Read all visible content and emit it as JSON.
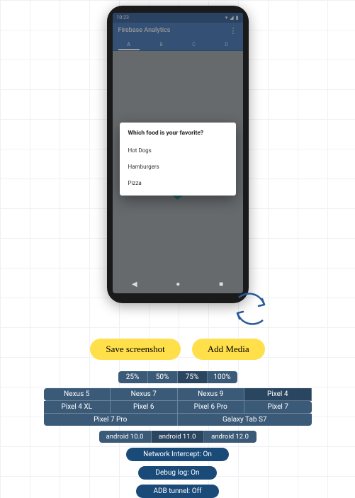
{
  "phone": {
    "status_time": "10:23",
    "app_title": "Firebase Analytics",
    "tabs": [
      "A",
      "B",
      "C",
      "D"
    ],
    "active_tab_index": 0,
    "dialog": {
      "title": "Which food is your favorite?",
      "options": [
        "Hot Dogs",
        "Hamburgers",
        "Pizza"
      ]
    },
    "nav_back": "◀",
    "nav_home": "●",
    "nav_recent": "■"
  },
  "actions": {
    "save_screenshot": "Save screenshot",
    "add_media": "Add Media"
  },
  "zoom": {
    "levels": [
      "25%",
      "50%",
      "75%",
      "100%"
    ],
    "active_index": 2
  },
  "devices": {
    "row1": [
      "Nexus 5",
      "Nexus 7",
      "Nexus 9",
      "Pixel 4"
    ],
    "row2": [
      "Pixel 4 XL",
      "Pixel 6",
      "Pixel 6 Pro",
      "Pixel 7"
    ],
    "row3": [
      "Pixel 7 Pro",
      "Galaxy Tab S7"
    ],
    "active": "Pixel 4"
  },
  "os": {
    "versions": [
      "android 10.0",
      "android 11.0",
      "android 12.0"
    ],
    "active_index": 1
  },
  "toggles": {
    "network": "Network Intercept: On",
    "debug": "Debug log: On",
    "adb": "ADB tunnel: Off"
  }
}
